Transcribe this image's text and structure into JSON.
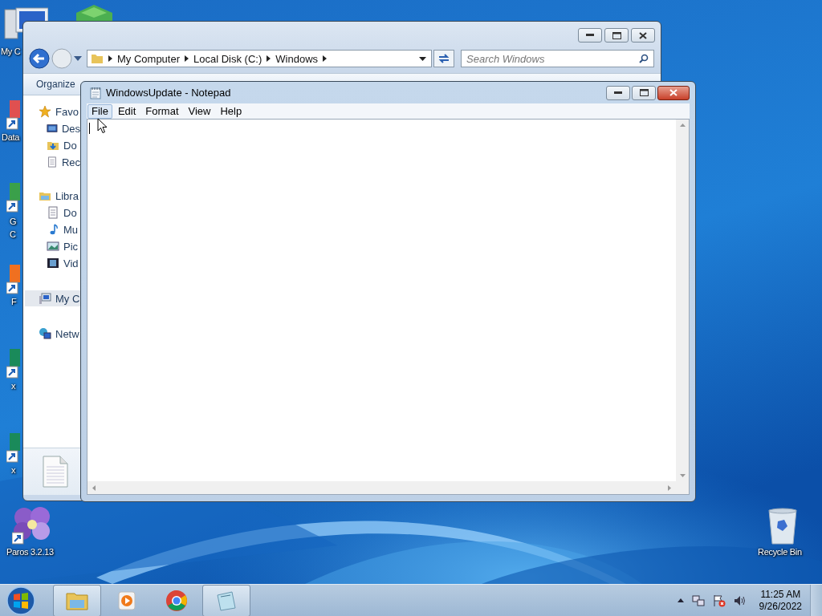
{
  "desktop_icons": [
    {
      "label": "My C"
    },
    {
      "label": "Data"
    },
    {
      "label": "G C"
    },
    {
      "label": "F"
    },
    {
      "label": "x"
    },
    {
      "label": "x"
    }
  ],
  "desktop_right": {
    "label": "Recycle Bin"
  },
  "desktop_bottom": {
    "label": "Paros 3.2.13"
  },
  "explorer": {
    "breadcrumb": [
      "My Computer",
      "Local Disk (C:)",
      "Windows"
    ],
    "search": {
      "placeholder": "Search Windows"
    },
    "toolbar": [
      "Organize"
    ],
    "sidebar": [
      {
        "label": "Favo",
        "kind": "group",
        "selected": false
      },
      {
        "label": "Des",
        "kind": "item",
        "selected": false
      },
      {
        "label": "Do",
        "kind": "item",
        "selected": false
      },
      {
        "label": "Rec",
        "kind": "item",
        "selected": false
      },
      {
        "label": "Libra",
        "kind": "group",
        "selected": false
      },
      {
        "label": "Do",
        "kind": "item",
        "selected": false
      },
      {
        "label": "Mu",
        "kind": "item",
        "selected": false
      },
      {
        "label": "Pic",
        "kind": "item",
        "selected": false
      },
      {
        "label": "Vid",
        "kind": "item",
        "selected": false
      },
      {
        "label": "My C",
        "kind": "group",
        "selected": true
      },
      {
        "label": "Netw",
        "kind": "group",
        "selected": false
      }
    ]
  },
  "notepad": {
    "title": "WindowsUpdate - Notepad",
    "menu": [
      {
        "label": "File",
        "selected": true
      },
      {
        "label": "Edit",
        "selected": false
      },
      {
        "label": "Format",
        "selected": false
      },
      {
        "label": "View",
        "selected": false
      },
      {
        "label": "Help",
        "selected": false
      }
    ]
  },
  "taskbar": {
    "apps": [
      {
        "running": true
      },
      {
        "running": false
      },
      {
        "running": false
      },
      {
        "running": true
      }
    ],
    "clock": {
      "time": "11:25 AM",
      "date": "9/26/2022"
    }
  }
}
